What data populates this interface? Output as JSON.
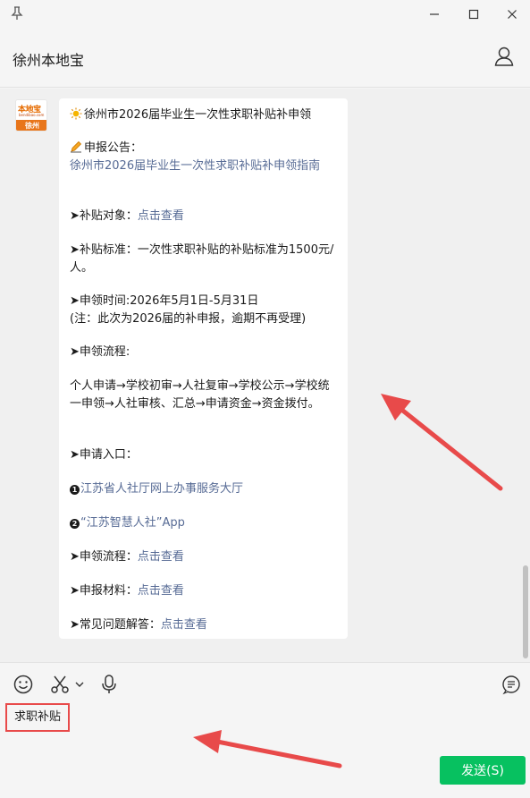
{
  "header": {
    "title": "徐州本地宝"
  },
  "contact": {
    "avatar_brand": "本地宝",
    "avatar_sub": "bendibao.com",
    "avatar_city": "徐州"
  },
  "message": {
    "title": "徐州市2026届毕业生一次性求职补贴补申领",
    "notice_label": "申报公告：",
    "notice_link": "徐州市2026届毕业生一次性求职补贴补申领指南",
    "target_label": "➤补贴对象：",
    "target_link": "点击查看",
    "standard_text": "➤补贴标准：一次性求职补贴的补贴标准为1500元/人。",
    "time_text": "➤申领时间:2026年5月1日-5月31日",
    "time_note": "(注：此次为2026届的补申报，逾期不再受理)",
    "process_label": "➤申领流程:",
    "process_text": "个人申请→学校初审→人社复审→学校公示→学校统一申领→人社审核、汇总→申请资金→资金拨付。",
    "entry_label": "➤申请入口：",
    "entry1_num": "1",
    "entry1_link": "江苏省人社厅网上办事服务大厅",
    "entry2_num": "2",
    "entry2_link": "“江苏智慧人社”App",
    "flow_label": "➤申领流程：",
    "flow_link": "点击查看",
    "materials_label": "➤申报材料：",
    "materials_link": "点击查看",
    "faq_label": "➤常见问题解答：",
    "faq_link": "点击查看"
  },
  "input": {
    "value": "求职补贴"
  },
  "send_button": {
    "label": "发送(S)"
  },
  "colors": {
    "send": "#07c160",
    "link": "#576b95",
    "annotation": "#e84a4a"
  },
  "icons": {
    "pin": "pin-icon",
    "minimize": "minimize-icon",
    "maximize": "maximize-icon",
    "close": "close-icon",
    "profile": "person-icon",
    "emoji": "emoji-icon",
    "screenshot": "scissors-icon",
    "voice": "microphone-icon",
    "chat_record": "chat-history-icon"
  }
}
